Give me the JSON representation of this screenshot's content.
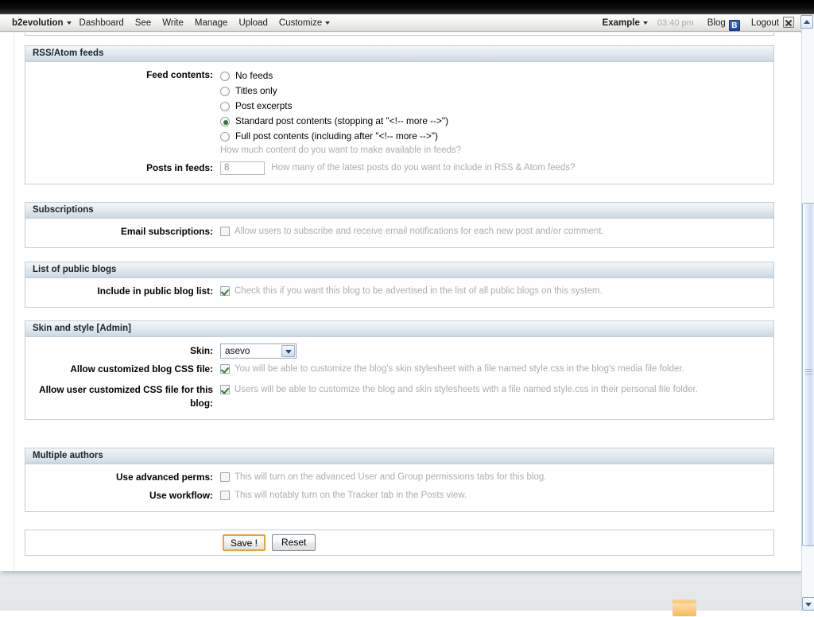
{
  "menubar": {
    "brand": "b2evolution",
    "items": [
      "Dashboard",
      "See",
      "Write",
      "Manage",
      "Upload",
      "Customize"
    ],
    "user": "Example",
    "time": "03:40 pm",
    "blog_label": "Blog",
    "blog_icon_letter": "B",
    "logout_label": "Logout"
  },
  "sections": {
    "rss": {
      "title": "RSS/Atom feeds",
      "feed_contents_label": "Feed contents:",
      "options": [
        "No feeds",
        "Titles only",
        "Post excerpts",
        "Standard post contents (stopping at \"<!-- more -->\")",
        "Full post contents (including after \"<!-- more -->\")"
      ],
      "selected_index": 3,
      "feed_help": "How much content do you want to make available in feeds?",
      "posts_label": "Posts in feeds:",
      "posts_value": "8",
      "posts_help": "How many of the latest posts do you want to include in RSS & Atom feeds?"
    },
    "subscriptions": {
      "title": "Subscriptions",
      "email_label": "Email subscriptions:",
      "email_checked": false,
      "email_help": "Allow users to subscribe and receive email notifications for each new post and/or comment."
    },
    "public_blogs": {
      "title": "List of public blogs",
      "include_label": "Include in public blog list:",
      "include_checked": true,
      "include_help": "Check this if you want this blog to be advertised in the list of all public blogs on this system."
    },
    "skin": {
      "title": "Skin and style [Admin]",
      "skin_label": "Skin:",
      "skin_value": "asevo",
      "blog_css_label": "Allow customized blog CSS file:",
      "blog_css_checked": true,
      "blog_css_help": "You will be able to customize the blog's skin stylesheet with a file named style.css in the blog's media file folder.",
      "user_css_label": "Allow user customized CSS file for this blog:",
      "user_css_checked": true,
      "user_css_help": "Users will be able to customize the blog and skin stylesheets with a file named style.css in their personal file folder."
    },
    "authors": {
      "title": "Multiple authors",
      "perms_label": "Use advanced perms:",
      "perms_checked": false,
      "perms_help": "This will turn on the advanced User and Group permissions tabs for this blog.",
      "workflow_label": "Use workflow:",
      "workflow_checked": false,
      "workflow_help": "This will notably turn on the Tracker tab in the Posts view."
    }
  },
  "buttons": {
    "save": "Save !",
    "reset": "Reset"
  },
  "colors": {
    "accent": "#e8a33d",
    "radio_dot": "#2e7d32",
    "check": "#2e7d32",
    "header_gradient_end": "#c9d6e1"
  }
}
